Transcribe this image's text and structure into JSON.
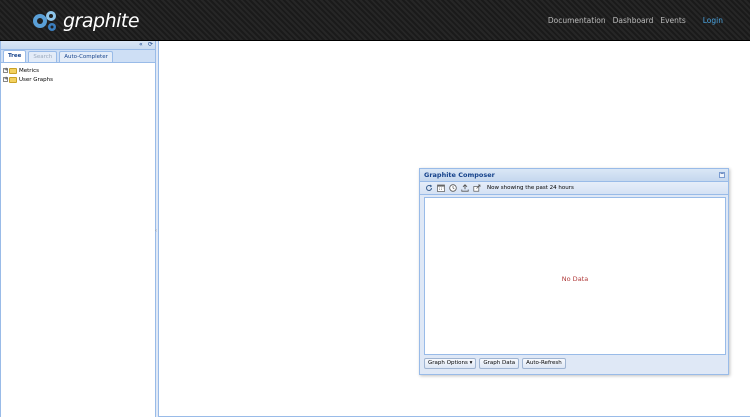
{
  "app": {
    "logo_text": "graphite"
  },
  "nav": {
    "links": [
      "Documentation",
      "Dashboard",
      "Events"
    ],
    "login": "Login"
  },
  "left_panel": {
    "tools": {
      "collapse": "«",
      "refresh": "⟳"
    },
    "tabs": [
      {
        "label": "Tree",
        "active": true
      },
      {
        "label": "Search",
        "active": false,
        "disabled": true
      },
      {
        "label": "Auto-Completer",
        "active": false
      }
    ],
    "tree": [
      {
        "label": "Metrics"
      },
      {
        "label": "User Graphs"
      }
    ]
  },
  "composer": {
    "title": "Graphite Composer",
    "toolbar": {
      "icons": [
        "refresh-icon",
        "calendar-icon",
        "clock-icon",
        "upload-icon",
        "share-icon"
      ],
      "status": "Now showing the past 24 hours"
    },
    "graph": {
      "message": "No Data"
    },
    "buttons": {
      "graph_options": "Graph Options ▾",
      "graph_data": "Graph Data",
      "auto_refresh": "Auto-Refresh"
    }
  },
  "colors": {
    "header_bg": "#1f1f1f",
    "panel_border": "#99bbe8",
    "link_accent": "#4aa3df",
    "no_data": "#b03a3a"
  }
}
